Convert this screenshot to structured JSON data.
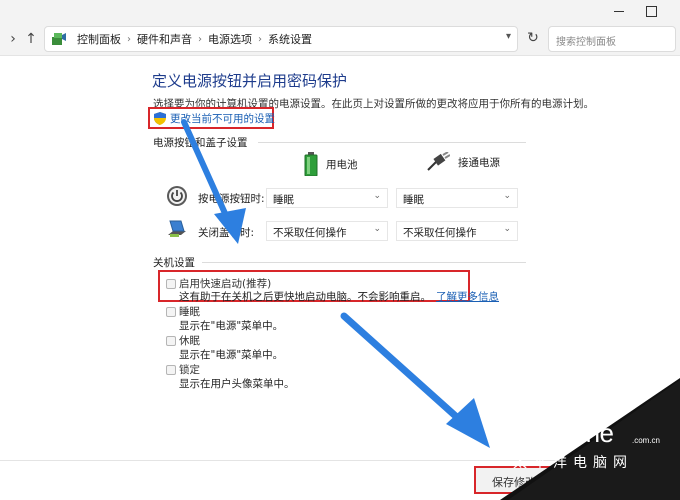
{
  "address_bar": {
    "breadcrumbs": [
      "控制面板",
      "硬件和声音",
      "电源选项",
      "系统设置"
    ],
    "search_placeholder": "搜索控制面板"
  },
  "header": {
    "title": "定义电源按钮并启用密码保护",
    "description": "选择要为你的计算机设置的电源设置。在此页上对设置所做的更改将应用于你所有的电源计划。",
    "change_link": "更改当前不可用的设置"
  },
  "power_section": {
    "label": "电源按钮和盖子设置",
    "columns": [
      "用电池",
      "接通电源"
    ],
    "rows": [
      {
        "label": "按电源按钮时:",
        "battery": "睡眠",
        "plugged": "睡眠",
        "icon": "power-icon"
      },
      {
        "label": "关闭盖子时:",
        "battery": "不采取任何操作",
        "plugged": "不采取任何操作",
        "icon": "laptop-lid-icon"
      }
    ]
  },
  "shutdown_section": {
    "label": "关机设置",
    "options": [
      {
        "title": "启用快速启动(推荐)",
        "desc": "这有助于在关机之后更快地启动电脑。不会影响重启。",
        "link": "了解更多信息"
      },
      {
        "title": "睡眠",
        "desc": "显示在\"电源\"菜单中。"
      },
      {
        "title": "休眠",
        "desc": "显示在\"电源\"菜单中。"
      },
      {
        "title": "锁定",
        "desc": "显示在用户头像菜单中。"
      }
    ]
  },
  "footer": {
    "save_label": "保存修改"
  },
  "watermark": {
    "logo": "PConline",
    "domain_suffix": ".com.cn",
    "subtitle": "太平洋电脑网"
  },
  "colors": {
    "title_blue": "#1e3c8c",
    "link_blue": "#1a5fb4",
    "highlight_red": "#d8262a",
    "arrow_blue": "#2d7fe0"
  }
}
